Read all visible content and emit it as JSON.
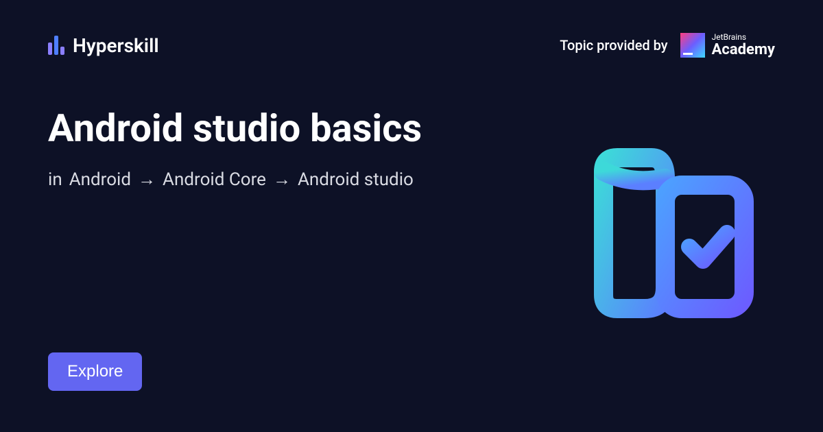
{
  "header": {
    "brand": "Hyperskill",
    "providedBy": "Topic provided by",
    "academyTop": "JetBrains",
    "academyBottom": "Academy"
  },
  "main": {
    "title": "Android studio basics",
    "breadcrumbPrefix": "in",
    "breadcrumb": [
      "Android",
      "Android Core",
      "Android studio"
    ]
  },
  "cta": {
    "explore": "Explore"
  }
}
